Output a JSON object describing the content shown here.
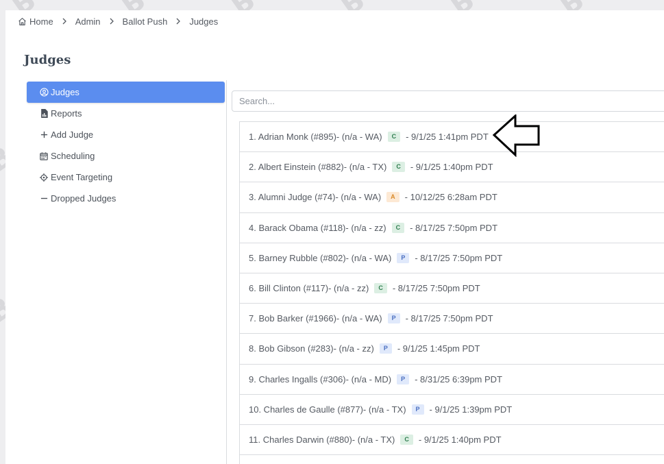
{
  "breadcrumb": {
    "home": "Home",
    "admin": "Admin",
    "ballot_push": "Ballot Push",
    "judges": "Judges"
  },
  "page_title": "Judges",
  "sidebar": {
    "items": [
      {
        "label": "Judges",
        "icon": "user-circle-icon",
        "active": true
      },
      {
        "label": "Reports",
        "icon": "report-file-icon",
        "active": false
      },
      {
        "label": "Add Judge",
        "icon": "plus-icon",
        "active": false
      },
      {
        "label": "Scheduling",
        "icon": "calendar-icon",
        "active": false
      },
      {
        "label": "Event Targeting",
        "icon": "target-icon",
        "active": false
      },
      {
        "label": "Dropped Judges",
        "icon": "minus-icon",
        "active": false
      }
    ]
  },
  "search": {
    "placeholder": "Search...",
    "value": ""
  },
  "judges": [
    {
      "text": "1. Adrian Monk (#895)- (n/a - WA)",
      "badge": "C",
      "time": "- 9/1/25 1:41pm PDT"
    },
    {
      "text": "2. Albert Einstein (#882)- (n/a - TX)",
      "badge": "C",
      "time": "- 9/1/25 1:40pm PDT"
    },
    {
      "text": "3. Alumni Judge (#74)- (n/a - WA)",
      "badge": "A",
      "time": "- 10/12/25 6:28am PDT"
    },
    {
      "text": "4. Barack Obama (#118)- (n/a - zz)",
      "badge": "C",
      "time": "- 8/17/25 7:50pm PDT"
    },
    {
      "text": "5. Barney Rubble (#802)- (n/a - WA)",
      "badge": "P",
      "time": "- 8/17/25 7:50pm PDT"
    },
    {
      "text": "6. Bill Clinton (#117)- (n/a - zz)",
      "badge": "C",
      "time": "- 8/17/25 7:50pm PDT"
    },
    {
      "text": "7. Bob Barker (#1966)- (n/a - WA)",
      "badge": "P",
      "time": "- 8/17/25 7:50pm PDT"
    },
    {
      "text": "8. Bob Gibson (#283)- (n/a - zz)",
      "badge": "P",
      "time": "- 9/1/25 1:45pm PDT"
    },
    {
      "text": "9. Charles Ingalls (#306)- (n/a - MD)",
      "badge": "P",
      "time": "- 8/31/25 6:39pm PDT"
    },
    {
      "text": "10. Charles de Gaulle (#877)- (n/a - TX)",
      "badge": "P",
      "time": "- 9/1/25 1:39pm PDT"
    },
    {
      "text": "11. Charles Darwin (#880)- (n/a - TX)",
      "badge": "C",
      "time": "- 9/1/25 1:40pm PDT"
    }
  ],
  "colors": {
    "accent": "#5b8def",
    "badge_c_bg": "#dcefe3",
    "badge_a_bg": "#fde9d4",
    "badge_p_bg": "#e0e9fb"
  }
}
